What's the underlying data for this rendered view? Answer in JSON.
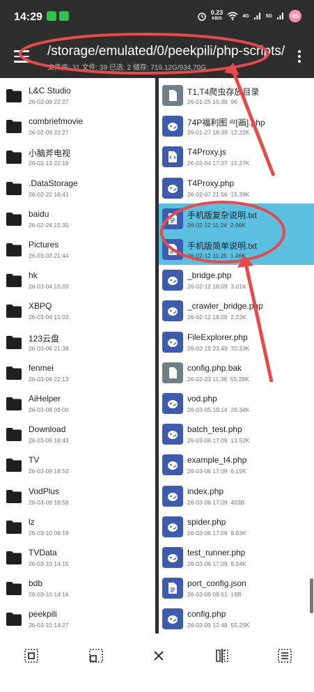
{
  "status": {
    "time": "14:29",
    "speed_value": "0.23",
    "speed_unit": "KB/S",
    "network": "4G",
    "network2": "5G",
    "battery": "95"
  },
  "header": {
    "path": "/storage/emulated/0/peekpili/php-scripts/",
    "info": "文件夹: 31  文件: 39  已选: 2  储存: 719.12G/934.70G"
  },
  "left_pane": {
    "items": [
      {
        "name": "L&C Studio",
        "date": "26-02-09 22:27"
      },
      {
        "name": "combriefmovie",
        "date": "26-02-09 22:27"
      },
      {
        "name": "小脑斧电视",
        "date": "26-02-13 22:19"
      },
      {
        "name": ".DataStorage",
        "date": "26-02-22 16:41"
      },
      {
        "name": "baidu",
        "date": "26-02-24 15:35"
      },
      {
        "name": "Pictures",
        "date": "26-03-03 21:44"
      },
      {
        "name": "hk",
        "date": "26-03-04 15:03"
      },
      {
        "name": "XBPQ",
        "date": "26-03-04 15:03"
      },
      {
        "name": "123云盘",
        "date": "26-03-06 21:38"
      },
      {
        "name": "fenmei",
        "date": "26-03-06 22:13"
      },
      {
        "name": "AiHelper",
        "date": "26-03-08 09:00"
      },
      {
        "name": "Download",
        "date": "26-03-09 18:43"
      },
      {
        "name": "TV",
        "date": "26-03-09 18:53"
      },
      {
        "name": "VodPlus",
        "date": "26-03-09 18:58"
      },
      {
        "name": "lz",
        "date": "26-03-10 08:19"
      },
      {
        "name": "TVData",
        "date": "26-03-10 14:15"
      },
      {
        "name": "bdb",
        "date": "26-03-10 14:16"
      },
      {
        "name": "peekpili",
        "date": "26-03-10 14:27"
      }
    ]
  },
  "right_pane": {
    "items": [
      {
        "name": "T1,T4爬虫存放目录",
        "date": "26-01-25 15:39",
        "size": "96",
        "icon": "generic-file-icon",
        "selected": false
      },
      {
        "name": "74P福利图 ᵈᶻ[画].php",
        "date": "26-01-27 18:39",
        "size": "12.22K",
        "icon": "php-file-icon",
        "selected": false
      },
      {
        "name": "T4Proxy.js",
        "date": "26-02-04 17:37",
        "size": "15.27K",
        "icon": "code-file-icon",
        "selected": false
      },
      {
        "name": "T4Proxy.php",
        "date": "26-02-07 21:56",
        "size": "15.39K",
        "icon": "php-file-icon",
        "selected": false
      },
      {
        "name": "手机版复杂说明.txt",
        "date": "26-02-12 11:24",
        "size": "2.96K",
        "icon": "text-file-icon",
        "selected": true
      },
      {
        "name": "手机版简单说明.txt",
        "date": "26-02-12 11:25",
        "size": "1.46K",
        "icon": "text-file-icon",
        "selected": true
      },
      {
        "name": "_bridge.php",
        "date": "26-02-12 18:09",
        "size": "3.01K",
        "icon": "php-file-icon",
        "selected": false
      },
      {
        "name": "_crawler_bridge.php",
        "date": "26-02-12 18:09",
        "size": "2.22K",
        "icon": "php-file-icon",
        "selected": false
      },
      {
        "name": "FileExplorer.php",
        "date": "26-02-19 23:49",
        "size": "70.33K",
        "icon": "php-file-icon",
        "selected": false
      },
      {
        "name": "config.php.bak",
        "date": "26-02-23 11:38",
        "size": "55.29K",
        "icon": "generic-file-icon",
        "selected": false
      },
      {
        "name": "vod.php",
        "date": "26-03-05 19:14",
        "size": "28.34K",
        "icon": "php-file-icon",
        "selected": false
      },
      {
        "name": "batch_test.php",
        "date": "26-03-06 17:09",
        "size": "13.52K",
        "icon": "php-file-icon",
        "selected": false
      },
      {
        "name": "example_t4.php",
        "date": "26-03-06 17:09",
        "size": "6.15K",
        "icon": "php-file-icon",
        "selected": false
      },
      {
        "name": "index.php",
        "date": "26-03-06 17:09",
        "size": "403B",
        "icon": "php-file-icon",
        "selected": false
      },
      {
        "name": "spider.php",
        "date": "26-03-06 17:09",
        "size": "9.83K",
        "icon": "php-file-icon",
        "selected": false
      },
      {
        "name": "test_runner.php",
        "date": "26-03-06 17:09",
        "size": "9.54K",
        "icon": "php-file-icon",
        "selected": false
      },
      {
        "name": "port_config.json",
        "date": "26-03-09 08:51",
        "size": "18B",
        "icon": "text-file-icon",
        "selected": false
      },
      {
        "name": "config.php",
        "date": "26-03-09 12:48",
        "size": "55.29K",
        "icon": "php-file-icon",
        "selected": false
      }
    ]
  },
  "bottom_bar": {
    "buttons": [
      "select-all-icon",
      "select-range-icon",
      "close-icon",
      "invert-selection-icon",
      "selection-list-icon"
    ]
  },
  "colors": {
    "dark_bg": "#2e2e2e",
    "selection": "#5bbfdf",
    "icon_blue": "#3e5cad",
    "annotation_red": "#e84a4a"
  }
}
